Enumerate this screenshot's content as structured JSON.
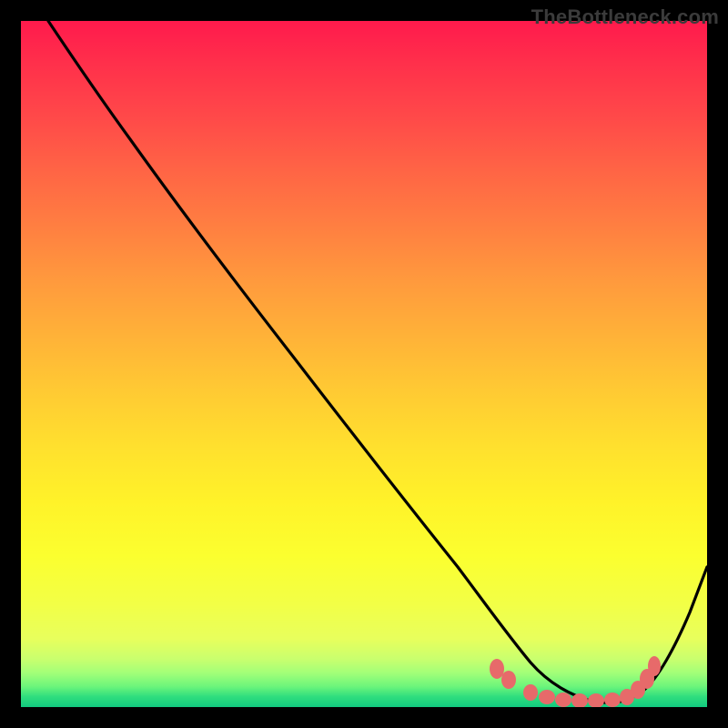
{
  "watermark": "TheBottleneck.com",
  "chart_data": {
    "type": "line",
    "title": "",
    "xlabel": "",
    "ylabel": "",
    "xlim": [
      0,
      100
    ],
    "ylim": [
      0,
      100
    ],
    "grid": false,
    "legend": false,
    "series": [
      {
        "name": "curve",
        "type": "line",
        "color": "#000000",
        "x": [
          4,
          8,
          15,
          25,
          35,
          45,
          55,
          63,
          68,
          72,
          75,
          78,
          81,
          84,
          87,
          90,
          93,
          96,
          100
        ],
        "y": [
          100,
          97,
          92,
          80,
          67,
          54,
          41,
          30,
          22,
          15,
          10,
          7,
          4,
          2.5,
          1.8,
          2,
          5,
          12,
          24
        ]
      },
      {
        "name": "bottom-dots",
        "type": "scatter",
        "color": "#e76a6a",
        "x": [
          69,
          71,
          75,
          77,
          79,
          81,
          83,
          85,
          87,
          89,
          90,
          91,
          92
        ],
        "y": [
          6.5,
          5,
          2.8,
          2.2,
          1.8,
          1.7,
          1.6,
          1.6,
          1.7,
          2.2,
          3.2,
          5.0,
          7.0
        ]
      }
    ],
    "gradient_stops": [
      {
        "pos": 0,
        "color": "#ff1a4c"
      },
      {
        "pos": 0.3,
        "color": "#ff7f41"
      },
      {
        "pos": 0.55,
        "color": "#ffca33"
      },
      {
        "pos": 0.78,
        "color": "#fbff2f"
      },
      {
        "pos": 0.95,
        "color": "#a3ff78"
      },
      {
        "pos": 1.0,
        "color": "#11c97f"
      }
    ]
  }
}
